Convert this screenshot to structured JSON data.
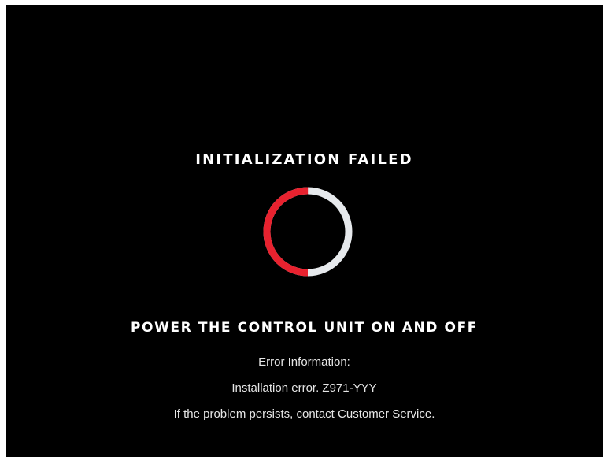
{
  "screen": {
    "title": "INITIALIZATION FAILED",
    "instruction": "POWER THE CONTROL UNIT ON AND OFF",
    "error_header": "Error Information:",
    "error_detail": "Installation error. Z971-YYY",
    "support_note": "If the problem persists, contact Customer Service."
  },
  "status_ring": {
    "icon": "failure-progress-ring-icon",
    "failed_fraction": 0.5,
    "colors": {
      "failed": "#e8222f",
      "remaining": "#e6e9ec",
      "background": "#000000"
    }
  }
}
